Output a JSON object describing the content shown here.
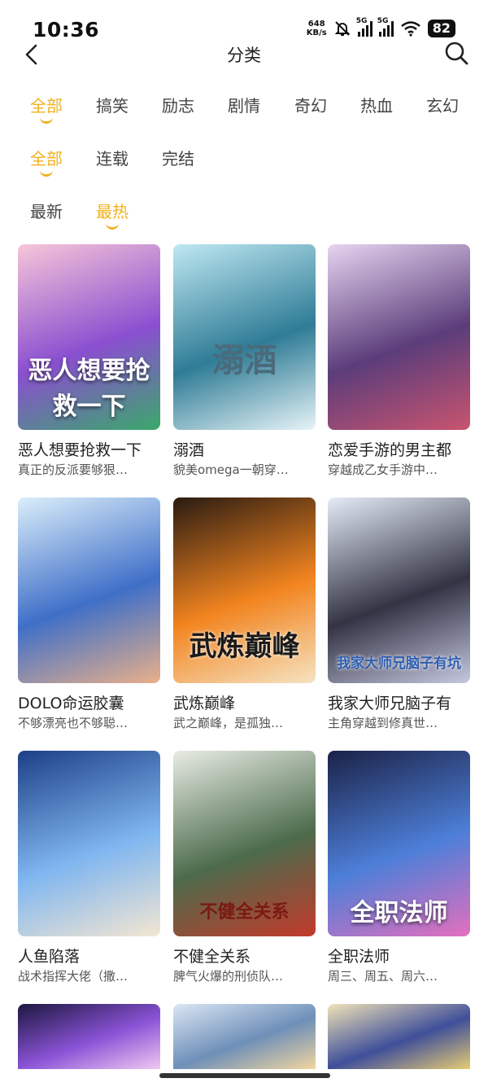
{
  "status_bar": {
    "time": "10:36",
    "net_speed_value": "648",
    "net_speed_unit": "KB/s",
    "sim1_label": "5G",
    "sim2_label": "5G",
    "battery": "82"
  },
  "header": {
    "title": "分类"
  },
  "genre_filters": [
    {
      "label": "全部",
      "active": true
    },
    {
      "label": "搞笑",
      "active": false
    },
    {
      "label": "励志",
      "active": false
    },
    {
      "label": "剧情",
      "active": false
    },
    {
      "label": "奇幻",
      "active": false
    },
    {
      "label": "热血",
      "active": false
    },
    {
      "label": "玄幻",
      "active": false
    }
  ],
  "status_filters": [
    {
      "label": "全部",
      "active": true
    },
    {
      "label": "连载",
      "active": false
    },
    {
      "label": "完结",
      "active": false
    }
  ],
  "sort_filters": [
    {
      "label": "最新",
      "active": false
    },
    {
      "label": "最热",
      "active": true
    }
  ],
  "comics": [
    {
      "title": "恶人想要抢救一下",
      "desc": "真正的反派要够狠…",
      "cover_text": "恶人想要抢救一下",
      "colors": [
        "#f7c6d9",
        "#8a4fd0",
        "#3aa86b"
      ]
    },
    {
      "title": "溺酒",
      "desc": "貌美omega一朝穿…",
      "cover_text": "溺酒",
      "colors": [
        "#bfe8f2",
        "#2f7c96",
        "#e7f4f7"
      ]
    },
    {
      "title": "恋爱手游的男主都",
      "desc": "穿越成乙女手游中…",
      "cover_text": "",
      "colors": [
        "#e6d4f0",
        "#5b3d7a",
        "#c9546f"
      ]
    },
    {
      "title": "DOLO命运胶囊",
      "desc": "不够漂亮也不够聪…",
      "cover_text": "",
      "colors": [
        "#dbeefa",
        "#3f6fc8",
        "#e9b08a"
      ]
    },
    {
      "title": "武炼巅峰",
      "desc": "武之巅峰，是孤独…",
      "cover_text": "武炼巅峰",
      "colors": [
        "#2a1b12",
        "#f2841f",
        "#f6e3c2"
      ]
    },
    {
      "title": "我家大师兄脑子有",
      "desc": "主角穿越到修真世…",
      "cover_text": "我家大师兄脑子有坑",
      "colors": [
        "#e4ecf7",
        "#333344",
        "#c6c8e0"
      ]
    },
    {
      "title": "人鱼陷落",
      "desc": "战术指挥大佬（撒…",
      "cover_text": "",
      "colors": [
        "#1d3f86",
        "#7fb6f0",
        "#f3e6d2"
      ]
    },
    {
      "title": "不健全关系",
      "desc": "脾气火爆的刑侦队…",
      "cover_text": "不健全关系",
      "colors": [
        "#e8ece4",
        "#4c6b4c",
        "#c33a2a"
      ]
    },
    {
      "title": "全职法师",
      "desc": "周三、周五、周六…",
      "cover_text": "全职法师",
      "colors": [
        "#1b2247",
        "#4d7fd8",
        "#e46fbd"
      ]
    },
    {
      "title": "",
      "desc": "",
      "cover_text": "",
      "colors": [
        "#1c1740",
        "#8a53d6",
        "#f0c9f2"
      ]
    },
    {
      "title": "",
      "desc": "",
      "cover_text": "",
      "colors": [
        "#dbe7f4",
        "#6e8fb8",
        "#f2d6a0"
      ]
    },
    {
      "title": "",
      "desc": "",
      "cover_text": "",
      "colors": [
        "#f1e3b8",
        "#3f4f9a",
        "#e6cc74"
      ]
    }
  ],
  "theme": {
    "accent": "#f0b21f"
  }
}
